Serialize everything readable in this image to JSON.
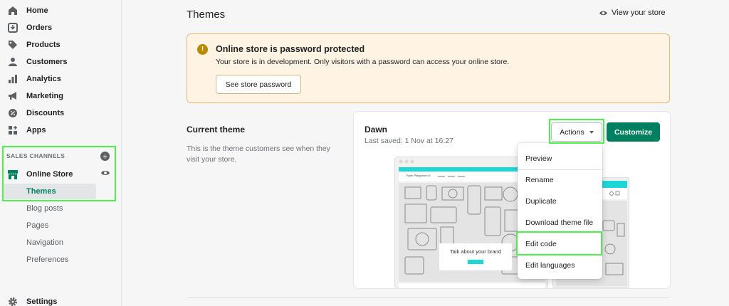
{
  "sidebar": {
    "items": [
      {
        "label": "Home",
        "icon": "home-icon"
      },
      {
        "label": "Orders",
        "icon": "orders-icon"
      },
      {
        "label": "Products",
        "icon": "tag-icon"
      },
      {
        "label": "Customers",
        "icon": "person-icon"
      },
      {
        "label": "Analytics",
        "icon": "bar-chart-icon"
      },
      {
        "label": "Marketing",
        "icon": "megaphone-icon"
      },
      {
        "label": "Discounts",
        "icon": "discount-icon"
      },
      {
        "label": "Apps",
        "icon": "apps-icon"
      }
    ],
    "channels_header": "SALES CHANNELS",
    "online_store": {
      "label": "Online Store",
      "subitems": [
        "Themes",
        "Blog posts",
        "Pages",
        "Navigation",
        "Preferences"
      ],
      "active": "Themes"
    },
    "settings_label": "Settings"
  },
  "header": {
    "title": "Themes",
    "view_store": "View your store"
  },
  "banner": {
    "title": "Online store is password protected",
    "text": "Your store is in development. Only visitors with a password can access your online store.",
    "button": "See store password"
  },
  "current_theme": {
    "heading": "Current theme",
    "description": "This is the theme customers see when they visit your store.",
    "name": "Dawn",
    "last_saved": "Last saved: 1 Nov at 16:27",
    "actions_label": "Actions",
    "customize_label": "Customize",
    "preview_store_name": "Ryan Playground 1",
    "preview_tagline": "Talk about your brand"
  },
  "dropdown": {
    "items": [
      "Preview",
      "Rename",
      "Duplicate",
      "Download theme file",
      "Edit code",
      "Edit languages"
    ]
  },
  "colors": {
    "brand_green": "#008060",
    "banner_bg": "#fff4e4",
    "highlight": "#4cf24c",
    "preview_accent": "#1fd6d6"
  }
}
